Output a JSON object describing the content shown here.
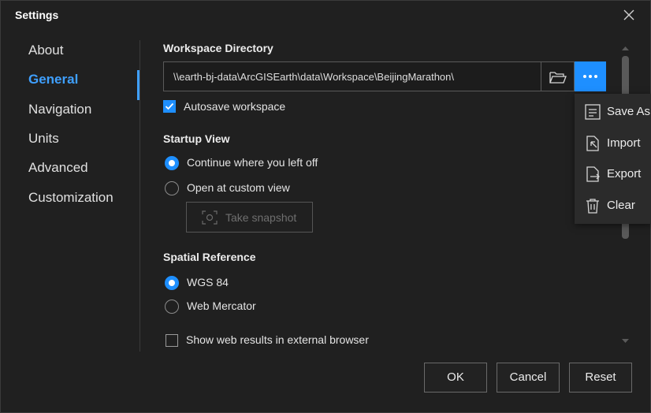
{
  "window": {
    "title": "Settings"
  },
  "sidebar": {
    "items": [
      {
        "label": "About"
      },
      {
        "label": "General"
      },
      {
        "label": "Navigation"
      },
      {
        "label": "Units"
      },
      {
        "label": "Advanced"
      },
      {
        "label": "Customization"
      }
    ],
    "active": "General"
  },
  "workspace": {
    "title": "Workspace Directory",
    "path": "\\\\earth-bj-data\\ArcGISEarth\\data\\Workspace\\BeijingMarathon\\",
    "autosave_label": "Autosave workspace",
    "autosave_checked": true
  },
  "startup": {
    "title": "Startup View",
    "options": [
      {
        "label": "Continue where you left off",
        "checked": true
      },
      {
        "label": "Open at custom view",
        "checked": false
      }
    ],
    "snapshot_label": "Take snapshot"
  },
  "spatial": {
    "title": "Spatial Reference",
    "options": [
      {
        "label": "WGS 84",
        "checked": true
      },
      {
        "label": "Web Mercator",
        "checked": false
      }
    ]
  },
  "external_browser": {
    "label": "Show web results in external browser",
    "checked": false
  },
  "menu": {
    "items": [
      {
        "label": "Save As",
        "icon": "save-as-icon"
      },
      {
        "label": "Import",
        "icon": "import-icon"
      },
      {
        "label": "Export",
        "icon": "export-icon"
      },
      {
        "label": "Clear",
        "icon": "trash-icon"
      }
    ]
  },
  "footer": {
    "ok": "OK",
    "cancel": "Cancel",
    "reset": "Reset"
  },
  "colors": {
    "accent": "#1e8fff",
    "nav_active": "#3fa0ff",
    "background": "#202020"
  }
}
